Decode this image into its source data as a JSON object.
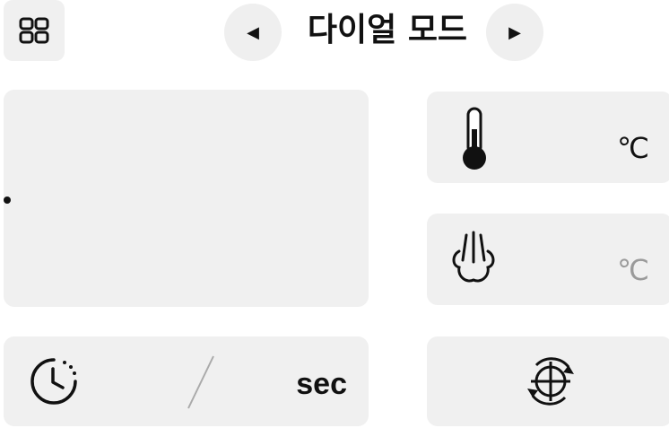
{
  "header": {
    "title": "다이얼 모드",
    "prev_glyph": "◀",
    "next_glyph": "▶",
    "menu_icon": "grid-icon"
  },
  "temperature": {
    "icon": "thermometer-icon",
    "unit": "℃"
  },
  "steam": {
    "icon": "steam-icon",
    "unit": "℃"
  },
  "timer": {
    "icon": "timer-icon",
    "unit": "sec"
  },
  "target": {
    "icon": "target-rotate-icon"
  },
  "colors": {
    "card": "#f0f0f0",
    "text": "#111111",
    "dim_text": "#9a9a9a"
  }
}
